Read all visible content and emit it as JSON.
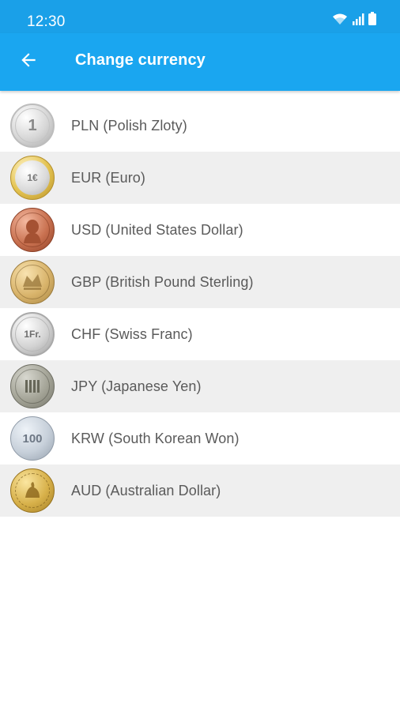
{
  "status_bar": {
    "time": "12:30",
    "icons": [
      "wifi-icon",
      "signal-icon",
      "battery-icon"
    ]
  },
  "app_bar": {
    "back_icon": "arrow-left-icon",
    "title": "Change currency"
  },
  "colors": {
    "status_bar": "#1aa0e8",
    "app_bar": "#1aa6f0",
    "row_alt": "#efefef",
    "text": "#5a5a5a"
  },
  "currencies": [
    {
      "code": "PLN",
      "label": "PLN (Polish Zloty)",
      "coin_glyph": "1",
      "icon": "pln-coin-icon"
    },
    {
      "code": "EUR",
      "label": "EUR (Euro)",
      "coin_glyph": "1€",
      "icon": "eur-coin-icon"
    },
    {
      "code": "USD",
      "label": "USD (United States Dollar)",
      "coin_glyph": "",
      "icon": "usd-coin-icon"
    },
    {
      "code": "GBP",
      "label": "GBP (British Pound Sterling)",
      "coin_glyph": "",
      "icon": "gbp-coin-icon"
    },
    {
      "code": "CHF",
      "label": "CHF (Swiss Franc)",
      "coin_glyph": "1Fr.",
      "icon": "chf-coin-icon"
    },
    {
      "code": "JPY",
      "label": "JPY (Japanese Yen)",
      "coin_glyph": "",
      "icon": "jpy-coin-icon"
    },
    {
      "code": "KRW",
      "label": "KRW (South Korean Won)",
      "coin_glyph": "100",
      "icon": "krw-coin-icon"
    },
    {
      "code": "AUD",
      "label": "AUD (Australian Dollar)",
      "coin_glyph": "",
      "icon": "aud-coin-icon"
    }
  ]
}
